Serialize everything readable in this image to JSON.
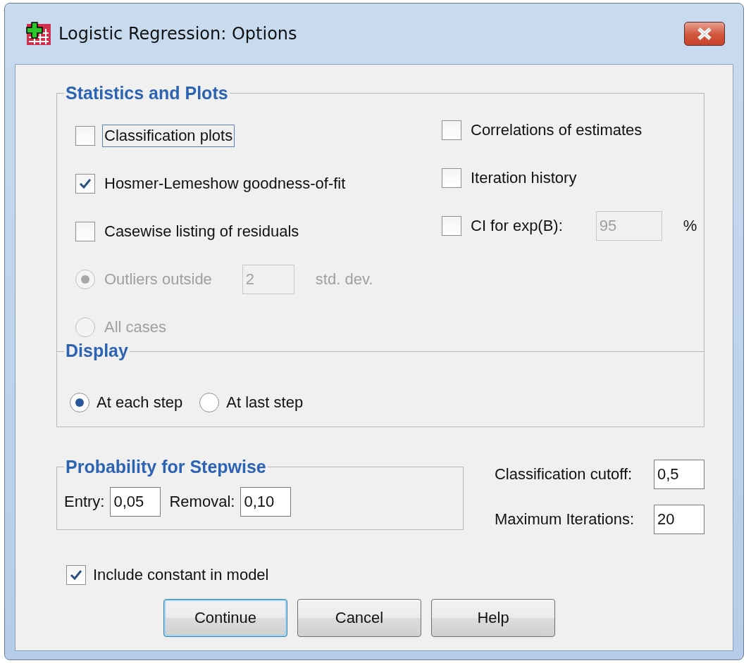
{
  "window": {
    "title": "Logistic Regression: Options"
  },
  "statistics_and_plots": {
    "title": "Statistics and Plots",
    "left": [
      {
        "kind": "checkbox",
        "label": "Classification plots",
        "checked": false,
        "disabled": false,
        "focused": true
      },
      {
        "kind": "checkbox",
        "label": "Hosmer-Lemeshow goodness-of-fit",
        "checked": true,
        "disabled": false,
        "focused": false
      },
      {
        "kind": "checkbox",
        "label": "Casewise listing of residuals",
        "checked": false,
        "disabled": false,
        "focused": false
      },
      {
        "kind": "radio",
        "label": "Outliers outside",
        "selected": true,
        "disabled": true,
        "field": {
          "value": "2",
          "disabled": true
        },
        "suffix": "std. dev."
      },
      {
        "kind": "radio",
        "label": "All cases",
        "selected": false,
        "disabled": true
      }
    ],
    "right": [
      {
        "kind": "checkbox",
        "label": "Correlations of estimates",
        "checked": false,
        "disabled": false
      },
      {
        "kind": "checkbox",
        "label": "Iteration history",
        "checked": false,
        "disabled": false
      },
      {
        "kind": "checkbox",
        "label": "CI for exp(B):",
        "checked": false,
        "disabled": false,
        "field": {
          "value": "95",
          "disabled": true
        },
        "suffix": "%"
      }
    ],
    "display": {
      "title": "Display",
      "options": [
        {
          "label": "At each step",
          "selected": true
        },
        {
          "label": "At last step",
          "selected": false
        }
      ]
    }
  },
  "probability": {
    "title": "Probability for Stepwise",
    "fields": [
      {
        "label": "Entry:",
        "value": "0,05"
      },
      {
        "label": "Removal:",
        "value": "0,10"
      }
    ]
  },
  "cutoffs": [
    {
      "label": "Classification cutoff:",
      "value": "0,5"
    },
    {
      "label": "Maximum Iterations:",
      "value": "20"
    }
  ],
  "include_constant": {
    "label": "Include constant in model",
    "checked": true
  },
  "buttons": [
    {
      "label": "Continue",
      "default": true
    },
    {
      "label": "Cancel",
      "default": false
    },
    {
      "label": "Help",
      "default": false
    }
  ]
}
